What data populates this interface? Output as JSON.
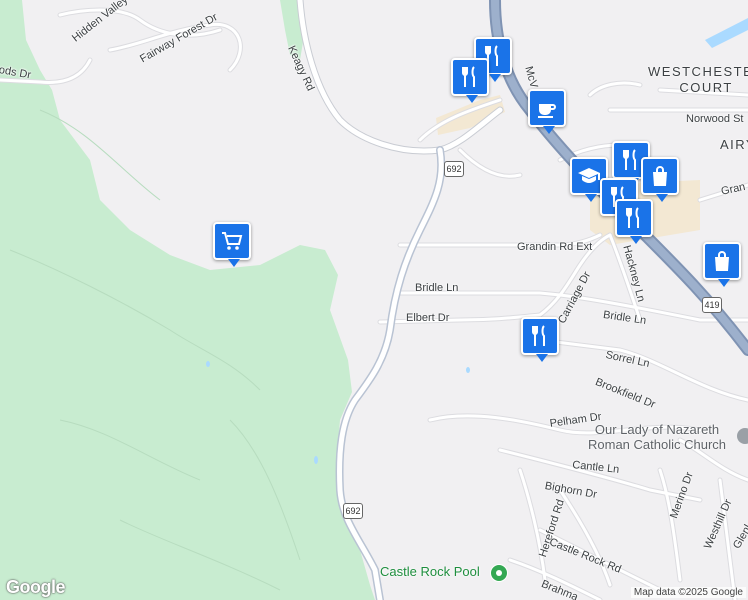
{
  "map": {
    "colors": {
      "land": "#f1f0f2",
      "park": "#c8ecd0",
      "road": "#ffffff",
      "road_edge": "#dcdce0",
      "highway": "#8fa5c4",
      "water": "#aadaff",
      "commercial": "#f3e8d3",
      "pin": "#1a73e8"
    },
    "roads": {
      "hidden_valley": "Hidden Valley Dr",
      "fairway_forest": "Fairway Forest Dr",
      "keagy": "Keagy Rd",
      "woods_dr": "ods Dr",
      "mcvitty": "McV",
      "norwood": "Norwood St",
      "grandin_ext": "Grandin Rd Ext",
      "grandin": "Gran",
      "bridle_ln_west": "Bridle Ln",
      "bridle_ln_east": "Bridle Ln",
      "elbert": "Elbert Dr",
      "carriage": "Carriage Dr",
      "hackney": "Hackney Ln",
      "sorrel": "Sorrel Ln",
      "brookfield": "Brookfield Dr",
      "pelham": "Pelham Dr",
      "cantle": "Cantle Ln",
      "bighorn": "Bighorn Dr",
      "merino": "Merino Dr",
      "hereford": "Hereford Rd",
      "castle_rock": "Castle Rock Rd",
      "westhill": "Westhill Dr",
      "glenl": "Glenl",
      "brahma": "Brahma"
    },
    "shields": {
      "route_692_top": "692",
      "route_692_bottom": "692",
      "route_419": "419"
    },
    "areas": {
      "westchester_line1": "WESTCHESTER",
      "westchester_line2": "COURT",
      "airy": "AIRY"
    },
    "places": {
      "church_line1": "Our Lady of Nazareth",
      "church_line2": "Roman Catholic Church",
      "pool": "Castle Rock Pool"
    },
    "pins": [
      {
        "id": "restaurant-1",
        "icon": "restaurant-icon"
      },
      {
        "id": "restaurant-2",
        "icon": "restaurant-icon"
      },
      {
        "id": "cafe",
        "icon": "coffee-cup-icon"
      },
      {
        "id": "school",
        "icon": "graduation-cap-icon"
      },
      {
        "id": "restaurant-3",
        "icon": "restaurant-icon"
      },
      {
        "id": "shopping-bag-1",
        "icon": "shopping-bag-icon"
      },
      {
        "id": "restaurant-4",
        "icon": "restaurant-icon"
      },
      {
        "id": "restaurant-5",
        "icon": "restaurant-icon"
      },
      {
        "id": "grocery",
        "icon": "shopping-cart-icon"
      },
      {
        "id": "shopping-bag-2",
        "icon": "shopping-bag-icon"
      },
      {
        "id": "restaurant-6",
        "icon": "restaurant-icon"
      }
    ],
    "logo": "Google",
    "attribution": "Map data ©2025 Google"
  }
}
